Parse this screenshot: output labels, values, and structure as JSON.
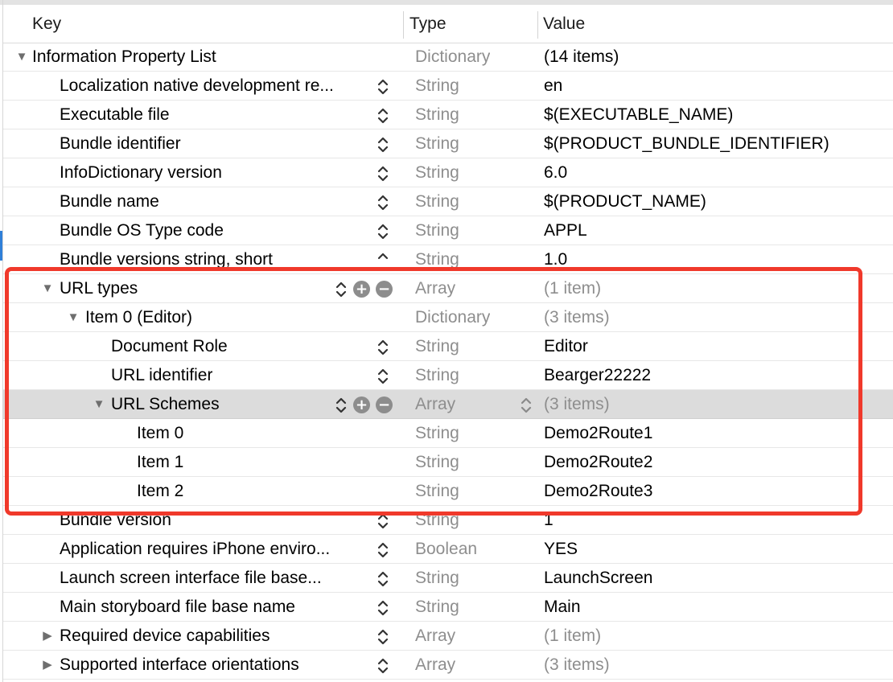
{
  "header": {
    "key": "Key",
    "type": "Type",
    "value": "Value"
  },
  "rows": [
    {
      "key": "Information Property List",
      "type": "Dictionary",
      "value": "(14 items)"
    },
    {
      "key": "Localization native development re...",
      "type": "String",
      "value": "en"
    },
    {
      "key": "Executable file",
      "type": "String",
      "value": "$(EXECUTABLE_NAME)"
    },
    {
      "key": "Bundle identifier",
      "type": "String",
      "value": "$(PRODUCT_BUNDLE_IDENTIFIER)"
    },
    {
      "key": "InfoDictionary version",
      "type": "String",
      "value": "6.0"
    },
    {
      "key": "Bundle name",
      "type": "String",
      "value": "$(PRODUCT_NAME)"
    },
    {
      "key": "Bundle OS Type code",
      "type": "String",
      "value": "APPL"
    },
    {
      "key": "Bundle versions string, short",
      "type": "String",
      "value": "1.0"
    },
    {
      "key": "URL types",
      "type": "Array",
      "value": "(1 item)"
    },
    {
      "key": "Item 0 (Editor)",
      "type": "Dictionary",
      "value": "(3 items)"
    },
    {
      "key": "Document Role",
      "type": "String",
      "value": "Editor"
    },
    {
      "key": "URL identifier",
      "type": "String",
      "value": "Bearger22222"
    },
    {
      "key": "URL Schemes",
      "type": "Array",
      "value": "(3 items)"
    },
    {
      "key": "Item 0",
      "type": "String",
      "value": "Demo2Route1"
    },
    {
      "key": "Item 1",
      "type": "String",
      "value": "Demo2Route2"
    },
    {
      "key": "Item 2",
      "type": "String",
      "value": "Demo2Route3"
    },
    {
      "key": "Bundle version",
      "type": "String",
      "value": "1"
    },
    {
      "key": "Application requires iPhone enviro...",
      "type": "Boolean",
      "value": "YES"
    },
    {
      "key": "Launch screen interface file base...",
      "type": "String",
      "value": "LaunchScreen"
    },
    {
      "key": "Main storyboard file base name",
      "type": "String",
      "value": "Main"
    },
    {
      "key": "Required device capabilities",
      "type": "Array",
      "value": "(1 item)"
    },
    {
      "key": "Supported interface orientations",
      "type": "Array",
      "value": "(3 items)"
    }
  ],
  "colors": {
    "highlight": "#f0392b",
    "selected_row": "#dcdcdc",
    "dim_text": "#8e8e8e"
  }
}
